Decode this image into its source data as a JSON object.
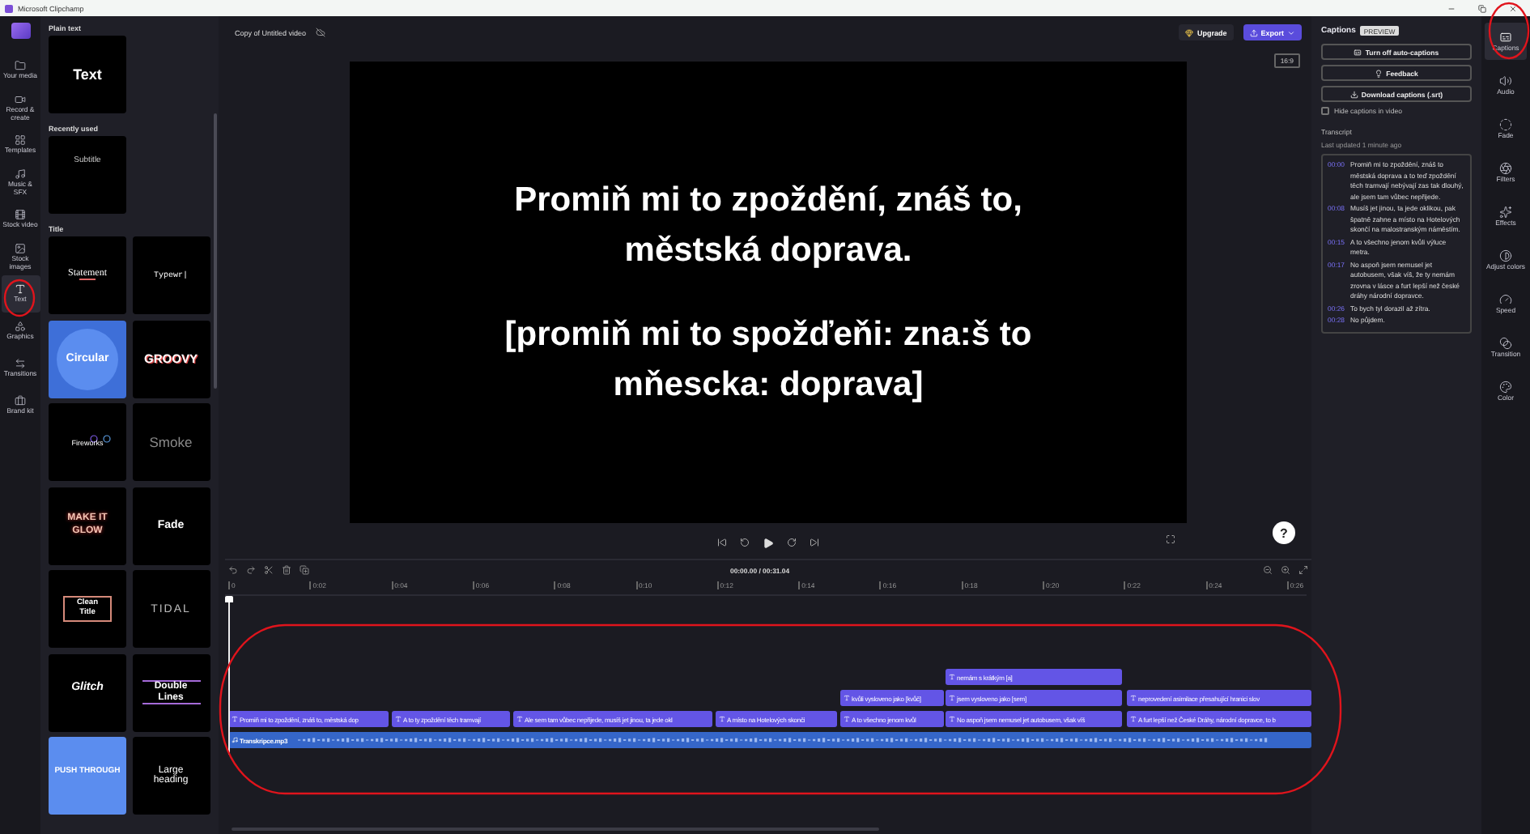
{
  "window": {
    "title": "Microsoft Clipchamp"
  },
  "nav_rail": [
    {
      "label": "Your media",
      "selected": false
    },
    {
      "label": "Record & create",
      "selected": false
    },
    {
      "label": "Templates",
      "selected": false
    },
    {
      "label": "Music & SFX",
      "selected": false
    },
    {
      "label": "Stock video",
      "selected": false
    },
    {
      "label": "Stock images",
      "selected": false
    },
    {
      "label": "Text",
      "selected": true
    },
    {
      "label": "Graphics",
      "selected": false
    },
    {
      "label": "Transitions",
      "selected": false
    },
    {
      "label": "Brand kit",
      "selected": false
    }
  ],
  "text_panel": {
    "sections": [
      {
        "heading": "Plain text",
        "cards": [
          {
            "kind": "plain",
            "label": "Text"
          }
        ]
      },
      {
        "heading": "Recently used",
        "cards": [
          {
            "kind": "subtitle",
            "label": "Subtitle"
          }
        ]
      },
      {
        "heading": "Title",
        "cards": [
          {
            "kind": "statement",
            "label": "Statement"
          },
          {
            "kind": "typewriter",
            "label": "Typewr|"
          },
          {
            "kind": "circular",
            "label": "Circular"
          },
          {
            "kind": "groovy",
            "label": "GROOVY"
          },
          {
            "kind": "fireworks",
            "label": "Fireworks"
          },
          {
            "kind": "smoke",
            "label": "Smoke"
          },
          {
            "kind": "glow",
            "label": "MAKE IT GLOW"
          },
          {
            "kind": "fade",
            "label": "Fade"
          },
          {
            "kind": "clean",
            "label": "Clean Title"
          },
          {
            "kind": "tidal",
            "label": "TIDAL"
          },
          {
            "kind": "glitch",
            "label": "Glitch"
          },
          {
            "kind": "double",
            "label": "Double Lines"
          },
          {
            "kind": "push",
            "label": "PUSH THROUGH"
          },
          {
            "kind": "large",
            "label": "Large heading"
          }
        ]
      }
    ]
  },
  "project": {
    "title": "Copy of Untitled video",
    "upgrade": "Upgrade",
    "export": "Export"
  },
  "preview": {
    "aspect": "16:9",
    "caption": [
      "Promiň mi to zpoždění, znáš to, městská doprava.",
      "[promiň mi to spožďeňi: zna:š to mňescka: doprava]"
    ],
    "help": "?"
  },
  "player": {
    "time": "00:00.00 / 00:31.04"
  },
  "timeline": {
    "ruler": [
      "0",
      "0:02",
      "0:04",
      "0:06",
      "0:08",
      "0:10",
      "0:12",
      "0:14",
      "0:16",
      "0:18",
      "0:20",
      "0:22",
      "0:24",
      "0:26"
    ],
    "tracks": [
      {
        "kind": "text",
        "clips": [
          "nemám s krátkým [a]"
        ]
      },
      {
        "kind": "text",
        "clips": [
          "kvůli vysloveno jako [kvůč]",
          "jsem vysloveno jako [sem]",
          "neprovedení asimilace přesahující hranici slov"
        ]
      },
      {
        "kind": "text",
        "clips": [
          "Promiň mi to zpoždění, znáš to, městská dop",
          "A to ty zpoždění těch tramvají",
          "Ale sem tam vůbec nepřijede, musíš jet jinou, ta jede okl",
          "A místo na Hotelových skonči",
          "A to všechno jenom kvůl",
          "No aspoň jsem nemusel jet autobusem, však víš",
          "A furt lepší než České Dráhy, národní dopravce, to b"
        ]
      },
      {
        "kind": "audio",
        "clips": [
          "Transkripce.mp3"
        ]
      }
    ]
  },
  "captions_panel": {
    "title": "Captions",
    "badge": "PREVIEW",
    "buttons": [
      {
        "kind": "captions",
        "label": "Turn off auto-captions"
      },
      {
        "kind": "feedback",
        "label": "Feedback"
      },
      {
        "kind": "download",
        "label": "Download captions (.srt)"
      }
    ],
    "hide_captions": {
      "label": "Hide captions in video",
      "checked": false
    },
    "transcript_heading": "Transcript",
    "updated": "Last updated 1 minute ago",
    "entries": [
      {
        "time": "00:00",
        "text": "Promiň mi to zpoždění, znáš to městská doprava a to teď zpoždění těch tramvají nebývají zas tak dlouhý, ale jsem tam vůbec nepřijede."
      },
      {
        "time": "00:08",
        "text": "Musíš jet jinou, ta jede oklikou, pak špatně zahne a místo na Hotelových skončí na malostranským náměstím."
      },
      {
        "time": "00:15",
        "text": "A to všechno jenom kvůli výluce metra."
      },
      {
        "time": "00:17",
        "text": "No aspoň jsem nemusel jet autobusem, však víš, že ty nemám zrovna v lásce a furt lepší než české dráhy národní dopravce."
      },
      {
        "time": "00:26",
        "text": "To bych tyl dorazil až zítra."
      },
      {
        "time": "00:28",
        "text": "No půjdem."
      }
    ]
  },
  "tool_rail": [
    {
      "label": "Captions",
      "selected": true
    },
    {
      "label": "Audio",
      "selected": false
    },
    {
      "label": "Fade",
      "selected": false
    },
    {
      "label": "Filters",
      "selected": false
    },
    {
      "label": "Effects",
      "selected": false
    },
    {
      "label": "Adjust colors",
      "selected": false
    },
    {
      "label": "Speed",
      "selected": false
    },
    {
      "label": "Transition",
      "selected": false
    },
    {
      "label": "Color",
      "selected": false
    }
  ]
}
